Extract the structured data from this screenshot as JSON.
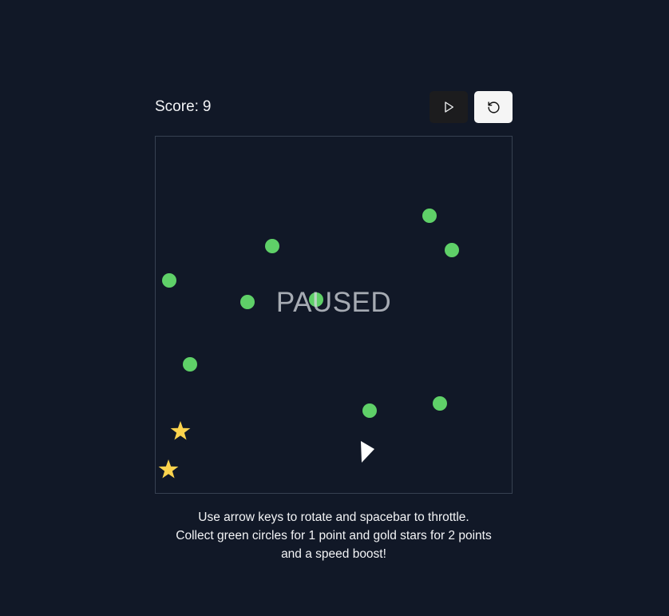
{
  "score": {
    "label": "Score:",
    "value": "9"
  },
  "controls": {
    "play_icon": "play-icon",
    "reset_icon": "rotate-ccw-icon"
  },
  "board": {
    "status_text": "PAUSED",
    "circle_color": "#5fd068",
    "star_color": "#fcd34d",
    "ship_color": "#ffffff"
  },
  "instructions": {
    "line1": "Use arrow keys to rotate and spacebar to throttle.",
    "line2": "Collect green circles for 1 point and gold stars for 2 points",
    "line3": "and a speed boost!"
  }
}
